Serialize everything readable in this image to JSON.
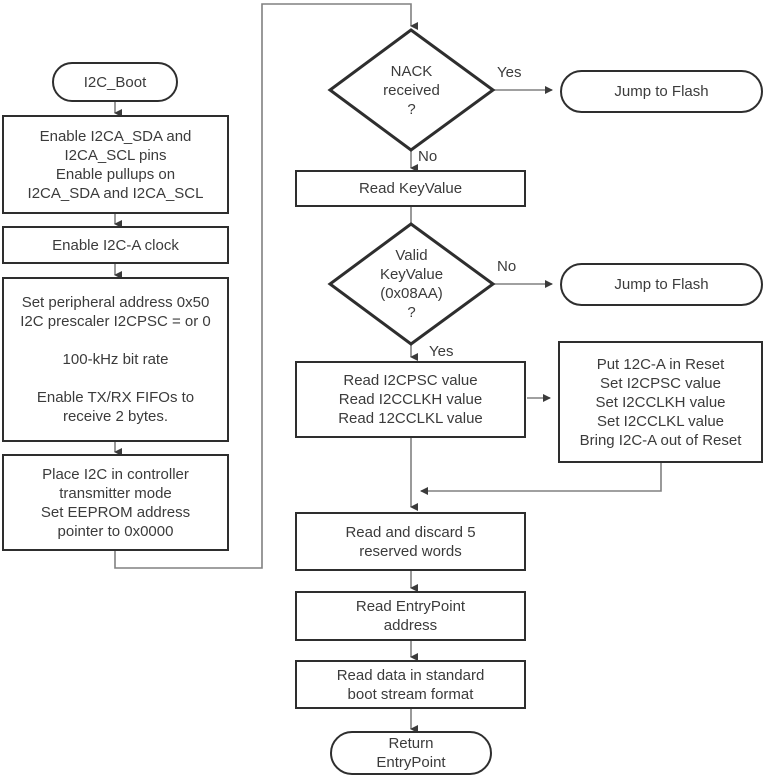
{
  "diagram": {
    "title": "I2C_Boot flowchart",
    "colors": {
      "shape_stroke": "#2e2e2e",
      "connector_stroke": "#808080",
      "text": "#3b3b3b",
      "background": "#ffffff"
    },
    "nodes": {
      "start": {
        "label": "I2C_Boot",
        "shape": "terminator"
      },
      "enable_pins": {
        "label": "Enable I2CA_SDA and\nI2CA_SCL pins\nEnable pullups on\nI2CA_SDA and I2CA_SCL",
        "shape": "process"
      },
      "enable_clock": {
        "label": "Enable I2C-A clock",
        "shape": "process"
      },
      "set_peripheral": {
        "label": "Set peripheral address 0x50\nI2C prescaler I2CPSC = or 0\n\n100-kHz bit rate\n\nEnable TX/RX FIFOs to\nreceive 2 bytes.",
        "shape": "process"
      },
      "place_i2c": {
        "label": "Place I2C in controller\ntransmitter mode\nSet EEPROM address\npointer to 0x0000",
        "shape": "process"
      },
      "nack_decision": {
        "label": "NACK\nreceived\n?",
        "shape": "decision"
      },
      "jump_flash_1": {
        "label": "Jump to Flash",
        "shape": "terminator"
      },
      "read_keyvalue": {
        "label": "Read KeyValue",
        "shape": "process"
      },
      "valid_keyvalue_decision": {
        "label": "Valid\nKeyValue\n(0x08AA)\n?",
        "shape": "decision"
      },
      "jump_flash_2": {
        "label": "Jump to Flash",
        "shape": "terminator"
      },
      "read_i2cpsc": {
        "label": "Read I2CPSC value\nRead I2CCLKH value\nRead 12CCLKL value",
        "shape": "process"
      },
      "put_i2c_reset": {
        "label": "Put 12C-A in Reset\nSet I2CPSC value\nSet I2CCLKH value\nSet I2CCLKL value\nBring I2C-A out of Reset",
        "shape": "process"
      },
      "read_discard": {
        "label": "Read and discard 5\nreserved words",
        "shape": "process"
      },
      "read_entrypoint": {
        "label": "Read EntryPoint\naddress",
        "shape": "process"
      },
      "read_data": {
        "label": "Read data in standard\nboot stream format",
        "shape": "process"
      },
      "return_entrypoint": {
        "label": "Return\nEntryPoint",
        "shape": "terminator"
      }
    },
    "edge_labels": {
      "nack_yes": "Yes",
      "nack_no": "No",
      "keyvalue_no": "No",
      "keyvalue_yes": "Yes"
    }
  }
}
